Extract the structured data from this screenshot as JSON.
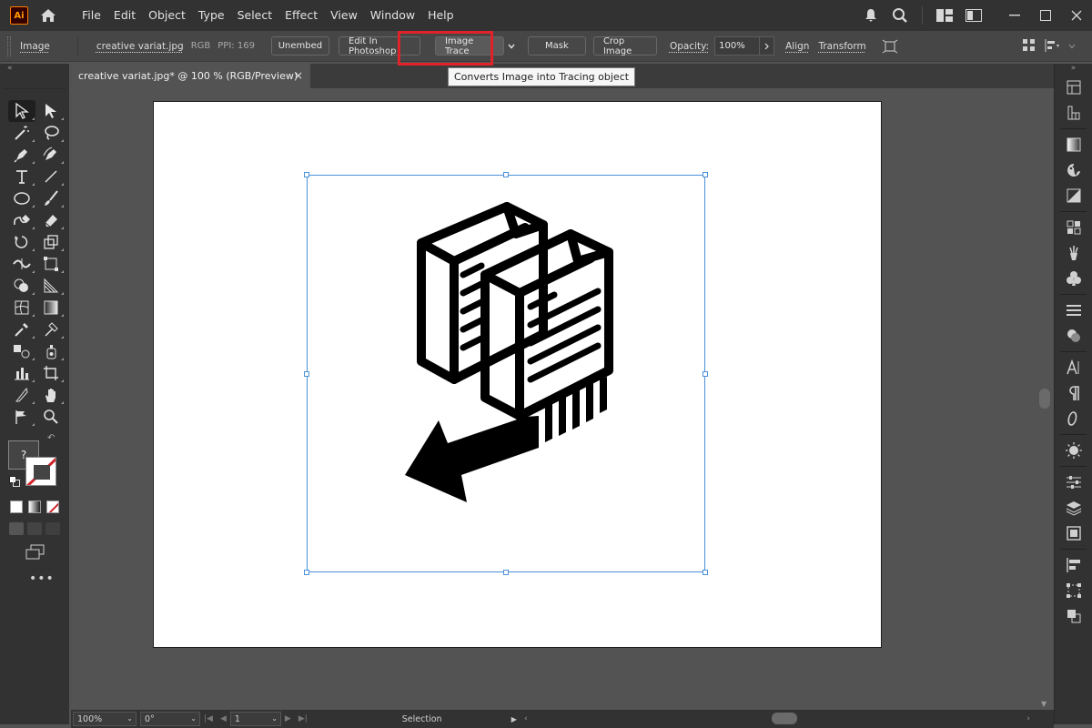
{
  "app": {
    "logo_text": "Ai",
    "menus": [
      "File",
      "Edit",
      "Object",
      "Type",
      "Select",
      "Effect",
      "View",
      "Window",
      "Help"
    ]
  },
  "control_bar": {
    "object_type": "Image",
    "file_name": "creative variat.jpg",
    "color_mode": "RGB",
    "ppi": "PPI: 169",
    "unembed_label": "Unembed",
    "edit_photoshop_label": "Edit In Photoshop",
    "image_trace_label": "Image Trace",
    "mask_label": "Mask",
    "crop_label": "Crop Image",
    "opacity_label": "Opacity:",
    "opacity_value": "100%",
    "align_label": "Align",
    "transform_label": "Transform"
  },
  "tooltip": {
    "text": "Converts Image into Tracing object"
  },
  "document": {
    "tab_title": "creative variat.jpg* @ 100 % (RGB/Preview)",
    "close_symbol": "×"
  },
  "left_toolbar": {
    "fill_unknown": "?"
  },
  "status_bar": {
    "zoom": "100%",
    "rotation": "0°",
    "artboard_number": "1",
    "tool_status": "Selection"
  },
  "colors": {
    "accent_highlight": "#e12228",
    "selection_blue": "#4a90d9",
    "logo_orange": "#ff9a00"
  }
}
